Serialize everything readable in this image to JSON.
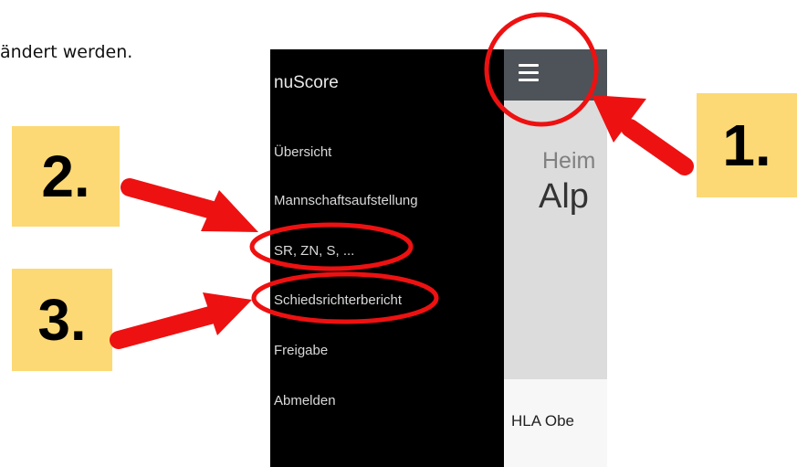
{
  "document": {
    "text_fragment": "ändert werden."
  },
  "drawer": {
    "brand": "nuScore",
    "items": [
      {
        "label": "Übersicht"
      },
      {
        "label": "Mannschaftsaufstellung"
      },
      {
        "label": "SR, ZN, S, ..."
      },
      {
        "label": "Schiedsrichterbericht"
      },
      {
        "label": "Freigabe"
      },
      {
        "label": "Abmelden"
      }
    ]
  },
  "main": {
    "hero_subtitle": "Heim",
    "hero_title": "Alp",
    "card_text": "HLA Obe"
  },
  "annotations": {
    "labels": [
      "1.",
      "2.",
      "3."
    ],
    "color_label_bg": "#fcd975",
    "color_markup": "#ee1111"
  },
  "icons": {
    "menu": "hamburger-menu-icon"
  }
}
